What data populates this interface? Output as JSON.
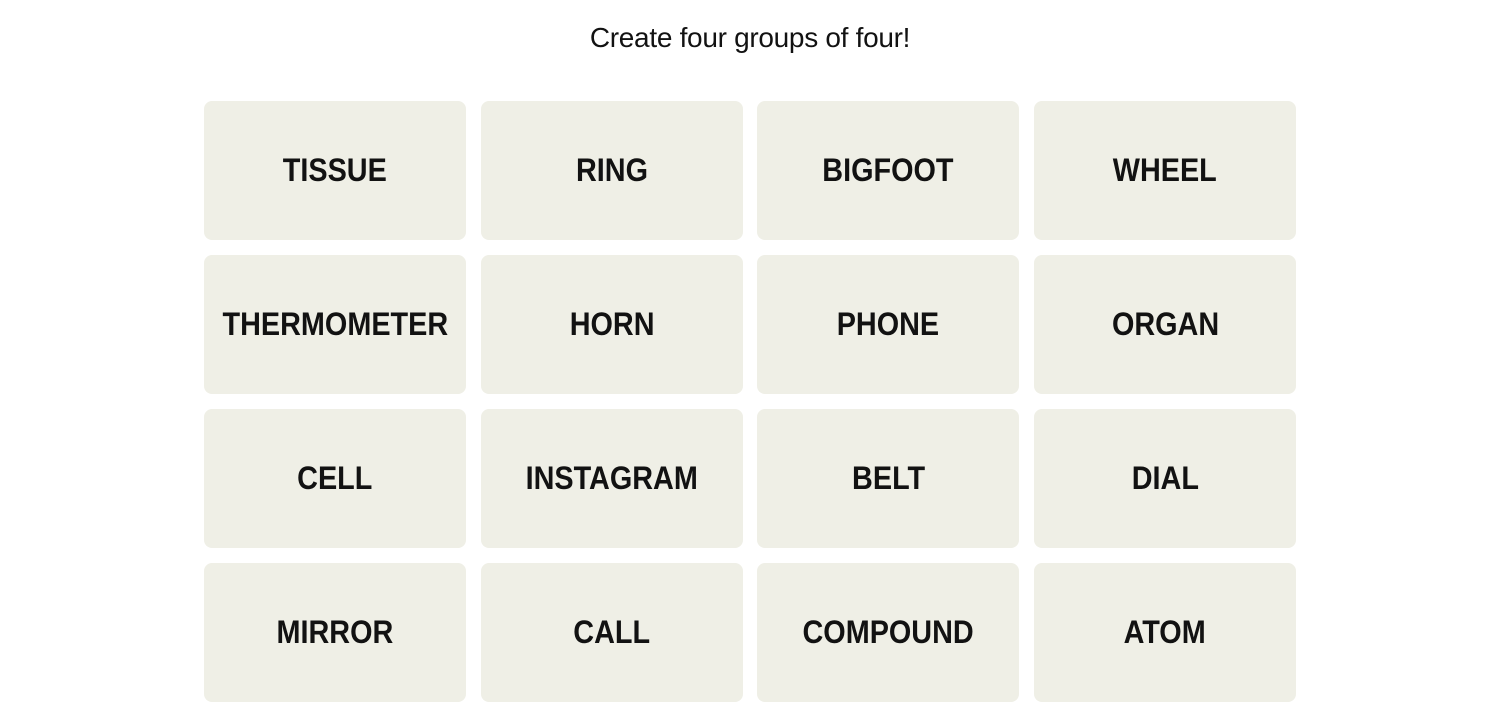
{
  "game": {
    "prompt": "Create four groups of four!",
    "tiles": [
      {
        "word": "TISSUE"
      },
      {
        "word": "RING"
      },
      {
        "word": "BIGFOOT"
      },
      {
        "word": "WHEEL"
      },
      {
        "word": "THERMOMETER"
      },
      {
        "word": "HORN"
      },
      {
        "word": "PHONE"
      },
      {
        "word": "ORGAN"
      },
      {
        "word": "CELL"
      },
      {
        "word": "INSTAGRAM"
      },
      {
        "word": "BELT"
      },
      {
        "word": "DIAL"
      },
      {
        "word": "MIRROR"
      },
      {
        "word": "CALL"
      },
      {
        "word": "COMPOUND"
      },
      {
        "word": "ATOM"
      }
    ]
  },
  "colors": {
    "tile_background": "#efefe6",
    "text": "#121212",
    "page_background": "#ffffff"
  }
}
